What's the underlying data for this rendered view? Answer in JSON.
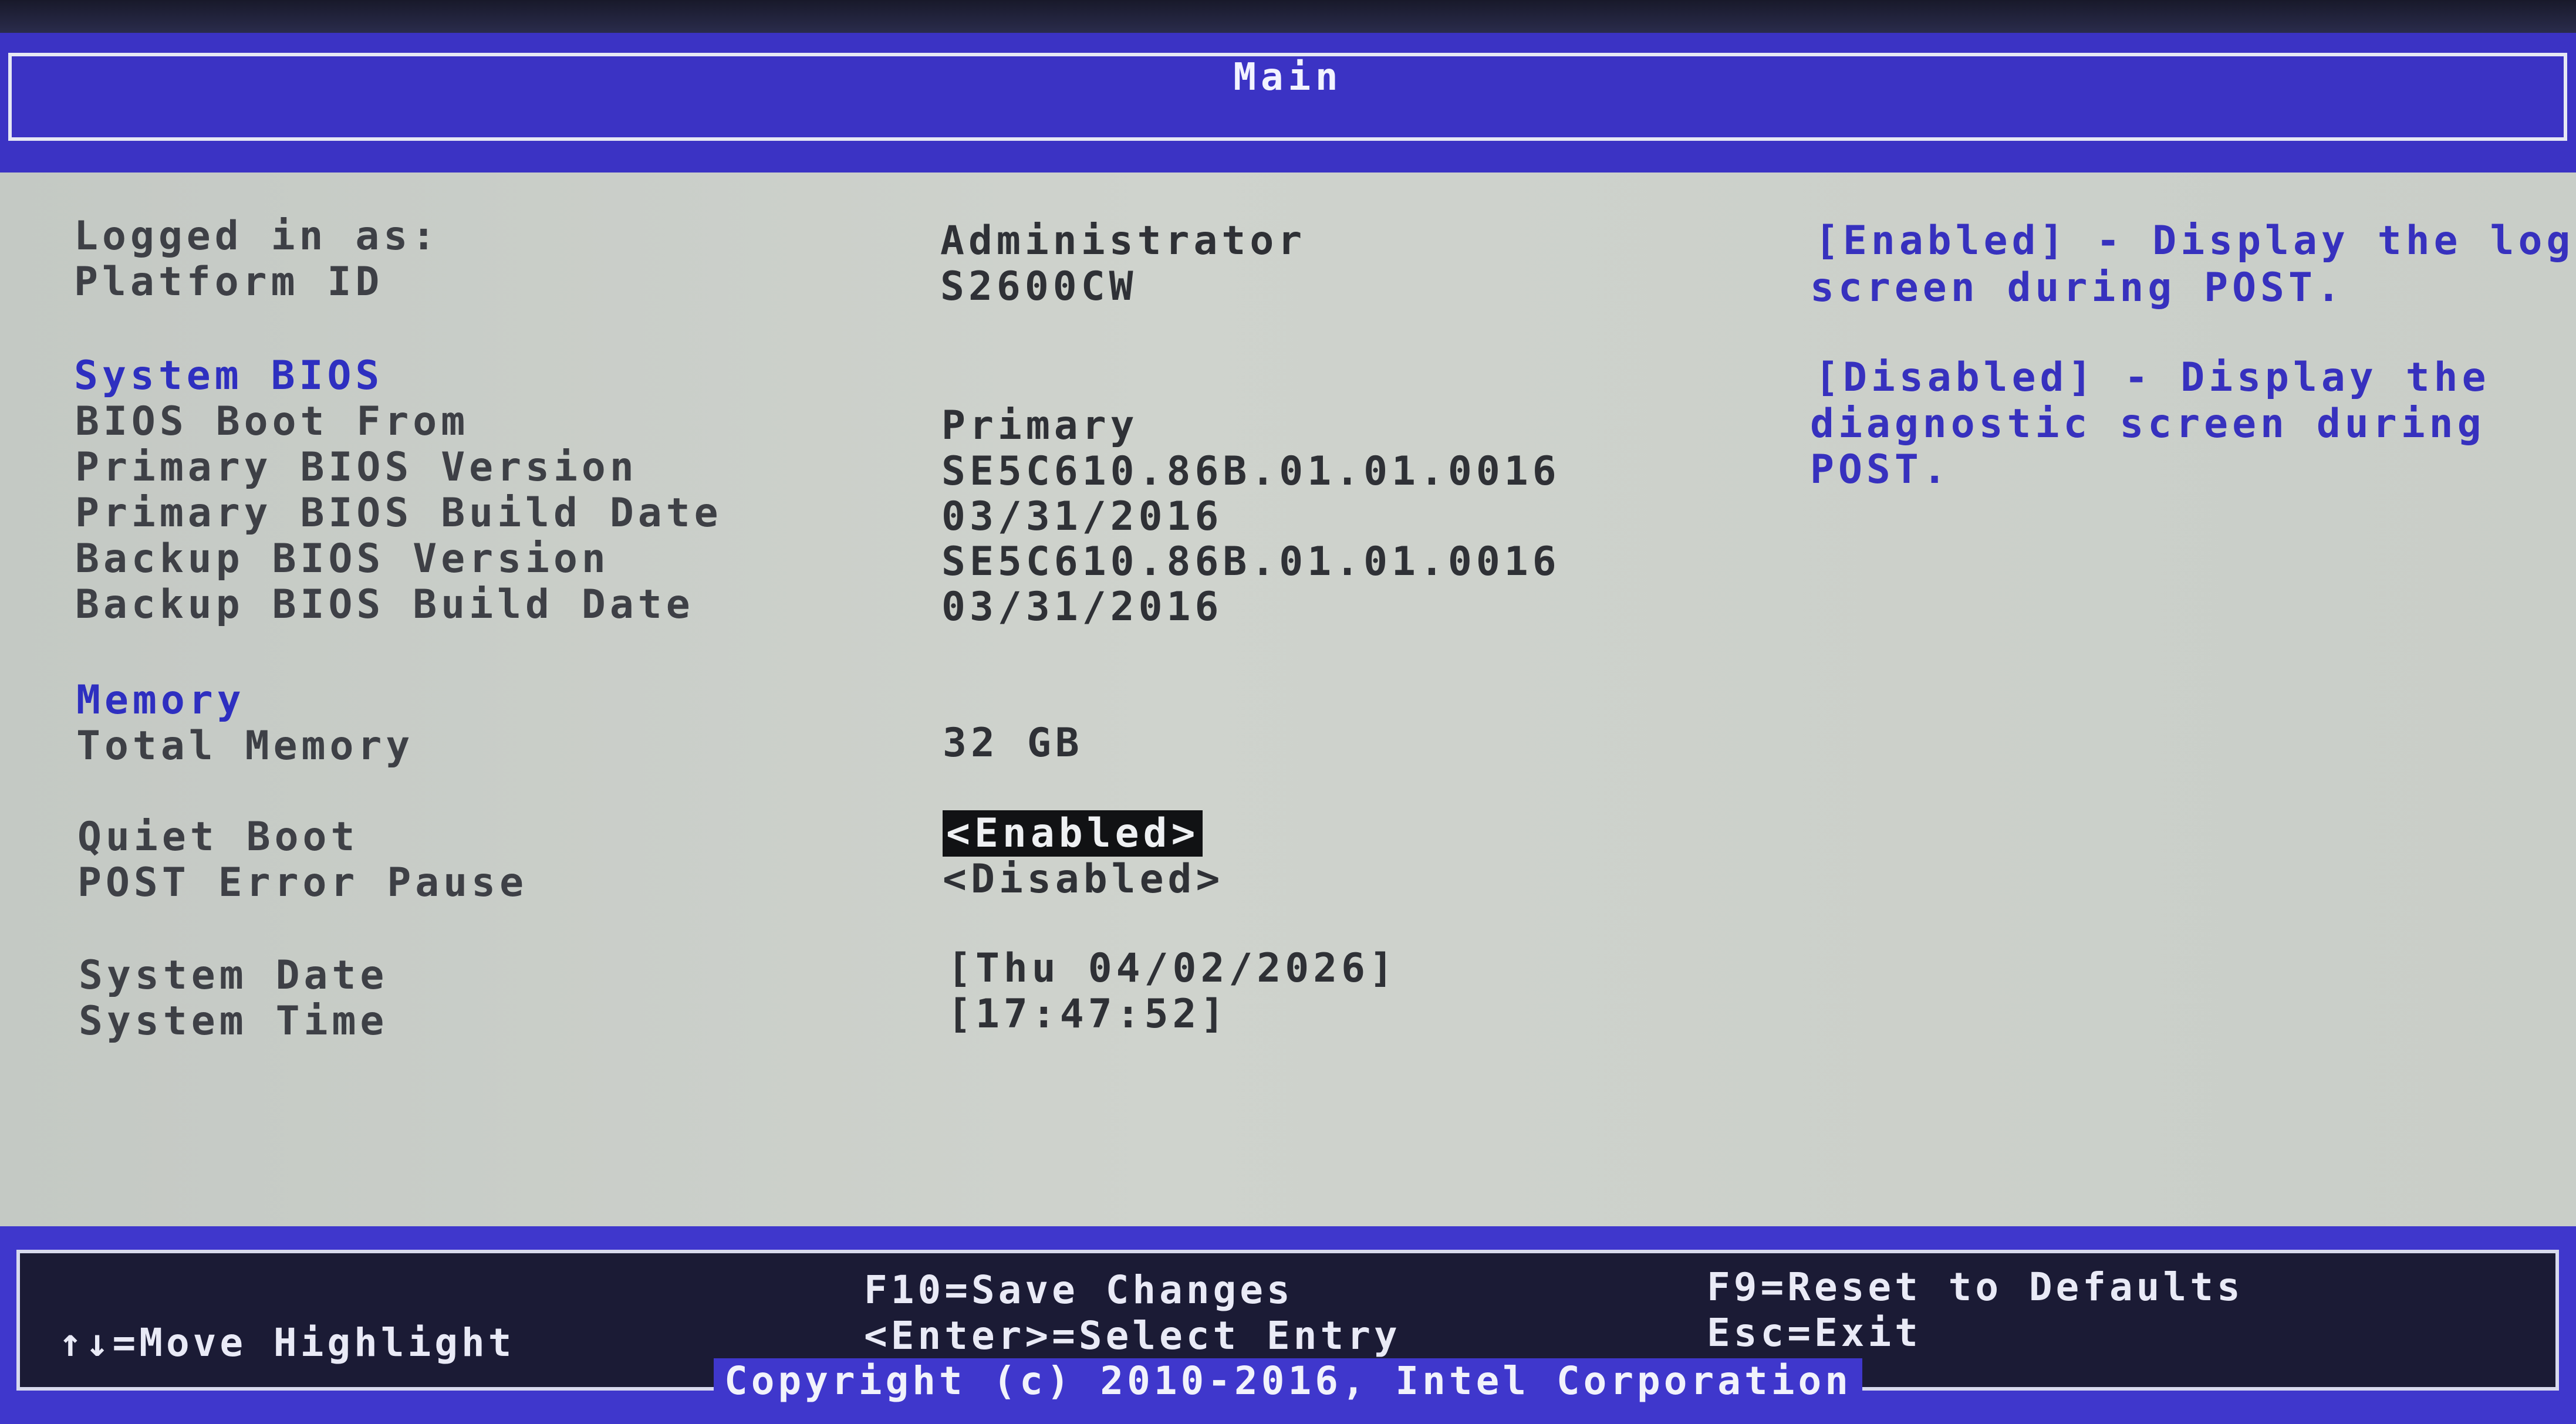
{
  "title": "Main",
  "info": {
    "logged_in_label": "Logged in as:",
    "logged_in_value": "Administrator",
    "platform_label": "Platform ID",
    "platform_value": "S2600CW"
  },
  "system_bios": {
    "heading": "System BIOS",
    "boot_from_label": "BIOS Boot From",
    "boot_from_value": "Primary",
    "primary_version_label": "Primary BIOS Version",
    "primary_version_value": "SE5C610.86B.01.01.0016",
    "primary_date_label": "Primary BIOS Build Date",
    "primary_date_value": "03/31/2016",
    "backup_version_label": "Backup BIOS Version",
    "backup_version_value": "SE5C610.86B.01.01.0016",
    "backup_date_label": "Backup BIOS Build Date",
    "backup_date_value": "03/31/2016"
  },
  "memory": {
    "heading": "Memory",
    "total_label": "Total Memory",
    "total_value": "32 GB"
  },
  "options": {
    "quiet_boot_label": "Quiet Boot",
    "quiet_boot_value": "<Enabled>",
    "post_error_label": "POST Error Pause",
    "post_error_value": "<Disabled>"
  },
  "datetime": {
    "date_label": "System Date",
    "date_value": "[Thu 04/02/2026]",
    "time_label": "System Time",
    "time_value": "[17:47:52]"
  },
  "help": {
    "line1": "[Enabled] - Display the logo",
    "line2": "screen during POST.",
    "line3": "[Disabled] - Display the",
    "line4": "diagnostic screen during",
    "line5": "POST."
  },
  "footer": {
    "move": "↑↓=Move Highlight",
    "save": "F10=Save Changes",
    "select": "<Enter>=Select Entry",
    "reset": "F9=Reset to Defaults",
    "exit": "Esc=Exit",
    "copyright": "Copyright (c) 2010-2016, Intel Corporation"
  },
  "colors": {
    "title_bar": "#3b33c4",
    "content_bg": "#cbd0ca",
    "section_heading": "#2e2fc0",
    "help_text": "#3731be",
    "footer_bg": "#1b1b35"
  }
}
